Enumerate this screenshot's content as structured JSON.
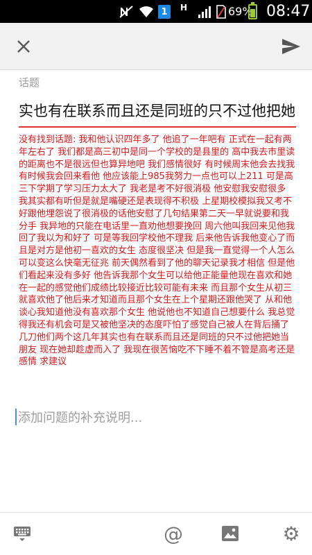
{
  "status_bar": {
    "notif_letter": "H",
    "badge_number": "1",
    "battery_percent": "69%",
    "battery_level": 0.69,
    "time": "08:47",
    "icons": [
      "mute-icon",
      "wifi-icon",
      "notification-badge",
      "h-signal-icon",
      "signal-icon",
      "no-sim-icon",
      "battery-icon"
    ]
  },
  "action_bar": {
    "close_icon": "close-icon",
    "send_icon": "send-icon"
  },
  "topic": {
    "label": "话题",
    "title": "实也有在联系而且还是同班的只不过他把她"
  },
  "body": {
    "text": "没有找到话题: 我和他认识四年多了 他追了一年吧有 正式在一起有两年左右了 我们都是高三初中是同一个学校的是县里的 高中我去市里读的距离也不是很远但也算异地吧 我们感情很好 有时候周末他会去找我有时候我会回来看他 他应该能上985我努力一点也可以上211 可是高三下学期了学习压力太大了 我老是考不好很消极 他安慰我安慰很多 我其实都有听但是就是嘴硬还是表现得不积极 上星期校模拟我又考不好跟他埋怨说了很消极的话他安慰了几句结果第二天一早就说要和我分手 我异地的只能在电话里一直劝他想要挽回 周六他叫我回来见他我回了我以为和好了 可是等我回学校他不理我 后来他告诉我他变心了而且是对方是他初一喜欢的女生 态度很坚决 但是我一直觉得一个人怎么可以变这么快毫无征兆 前天偶然看到了他的聊天记录我才相信 但是他们看起来没有多好 他告诉我那个女生可以给他正能量他现在喜欢和她在一起的感觉他们成绩比较接近比较可能有未来 而且那个女生从初三就喜欢他了他后来才知道而且那个女生在上个星期还跟他哭了 从和他谈心我知道他没有喜欢那个女生 他说他也不知道自己想要什么 我总觉得我还有机会可是又被他坚决的态度吓怕了感觉自己被人在背后捅了几刀他们两个这几年其实也有在联系而且还是同班的只不过他把她当朋友 现在她却趁虚而入了 我现在很苦恼吃不下睡不着不管是高考还是感情 求建议"
  },
  "supplement": {
    "placeholder": "添加问题的补充说明..."
  },
  "toolbar": {
    "keyboard_icon": "keyboard-icon",
    "mention_symbol": "@",
    "image_icon": "image-icon",
    "settings_symbol": "⚙"
  },
  "colors": {
    "accent_red": "#e0342c",
    "body_red": "#d7191c",
    "caret_blue": "#4a90d9"
  }
}
